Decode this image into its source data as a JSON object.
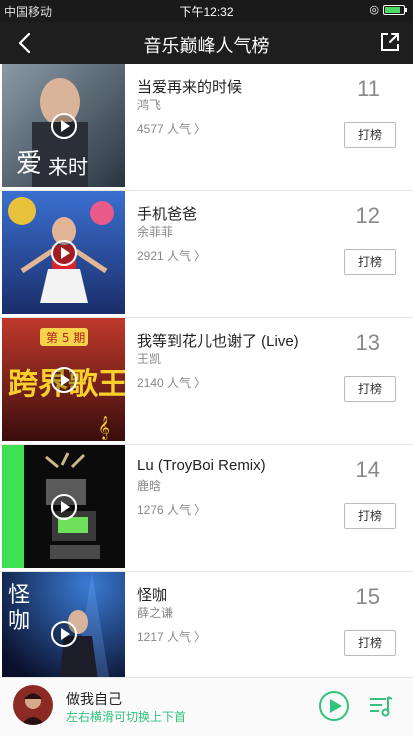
{
  "status": {
    "carrier": "中国移动",
    "time": "下午12:32"
  },
  "nav": {
    "title": "音乐巅峰人气榜"
  },
  "colors": {
    "accent": "#31c27c",
    "navbar": "#1e1e1e"
  },
  "songs": [
    {
      "title": "当爱再来的时候",
      "artist": "鸿飞",
      "popularity": "4577 人气",
      "rank": "11",
      "vote_label": "打榜"
    },
    {
      "title": "手机爸爸",
      "artist": "余菲菲",
      "popularity": "2921 人气",
      "rank": "12",
      "vote_label": "打榜"
    },
    {
      "title": "我等到花儿也谢了 (Live)",
      "artist": "王凯",
      "popularity": "2140 人气",
      "rank": "13",
      "vote_label": "打榜"
    },
    {
      "title": "Lu (TroyBoi Remix)",
      "artist": "鹿晗",
      "popularity": "1276 人气",
      "rank": "14",
      "vote_label": "打榜"
    },
    {
      "title": "怪咖",
      "artist": "薛之谦",
      "popularity": "1217 人气",
      "rank": "15",
      "vote_label": "打榜"
    }
  ],
  "player": {
    "title": "做我自己",
    "hint": "左右横滑可切换上下首"
  }
}
